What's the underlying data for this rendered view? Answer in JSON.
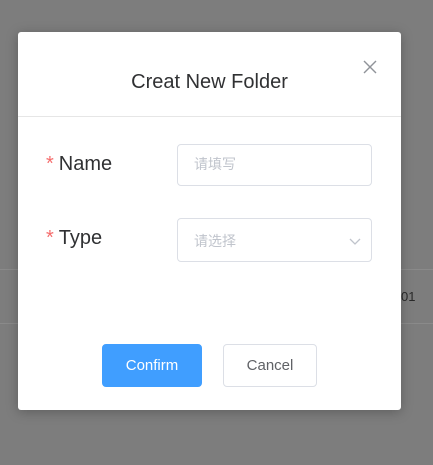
{
  "background": {
    "partial_text": "01"
  },
  "dialog": {
    "title": "Creat New Folder",
    "close_icon": "close-icon"
  },
  "form": {
    "required_mark": "*",
    "name": {
      "label": "Name",
      "placeholder": "请填写",
      "value": ""
    },
    "type": {
      "label": "Type",
      "placeholder": "请选择",
      "arrow_icon": "chevron-down-icon"
    }
  },
  "buttons": {
    "confirm": "Confirm",
    "cancel": "Cancel"
  },
  "colors": {
    "primary": "#409eff",
    "required": "#f56c6c",
    "overlay": "#7d7d7d"
  }
}
